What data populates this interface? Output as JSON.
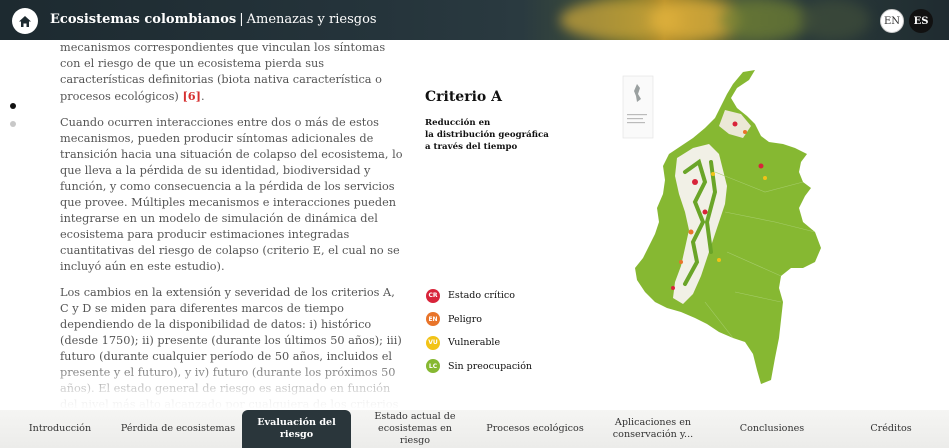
{
  "header": {
    "title_bold": "Ecosistemas colombianos",
    "separator": "|",
    "title_rest": "Amenazas y riesgos",
    "lang_en": "EN",
    "lang_es": "ES"
  },
  "body": {
    "p1_text": "mecanismos correspondientes que vinculan los síntomas con el riesgo de que un ecosistema pierda sus características definitorias (biota nativa característica o procesos ecológicos)",
    "p1_ref": "[6]",
    "p1_end": ".",
    "p2": "Cuando ocurren interacciones entre dos o más de estos mecanismos, pueden producir síntomas adicionales de transición hacia una situación de colapso del ecosistema, lo que lleva a la pérdida de su identidad, biodiversidad y función, y como consecuencia a la pérdida de los servicios que provee. Múltiples mecanismos e interacciones pueden integrarse en un modelo de simulación de dinámica del ecosistema para producir estimaciones integradas cuantitativas del riesgo de colapso (criterio E, el cual no se incluyó aún en este estudio).",
    "p3": "Los cambios en la extensión y severidad de los criterios A, C y D se miden para diferentes marcos de tiempo dependiendo de la disponibilidad de datos: i) histórico (desde 1750); ii) presente (durante los últimos 50 años); iii) futuro (durante cualquier período de 50 años, incluidos el presente y el futuro), y iv) futuro (durante los próximos 50 años). El estado general de riesgo es asignado en función del nivel más alto alcanzado por cualquiera de los criterios de evaluación, ya que el riesgo global se considera que está determinado por el factor más limitante."
  },
  "criterion": {
    "title": "Criterio A",
    "subtitle_1": "Reducción en",
    "subtitle_2": "la distribución geográfica",
    "subtitle_3": "a través del tiempo"
  },
  "legend": [
    {
      "code": "CR",
      "label": "Estado crítico",
      "color": "#d8243a"
    },
    {
      "code": "EN",
      "label": "Peligro",
      "color": "#e8742a"
    },
    {
      "code": "VU",
      "label": "Vulnerable",
      "color": "#f2c316"
    },
    {
      "code": "LC",
      "label": "Sin preocupación",
      "color": "#86b832"
    }
  ],
  "nav": [
    {
      "label": "Introducción",
      "active": false
    },
    {
      "label": "Pérdida de ecosistemas",
      "active": false
    },
    {
      "label": "Evaluación del riesgo",
      "active": true
    },
    {
      "label": "Estado actual de ecosistemas en riesgo",
      "active": false
    },
    {
      "label": "Procesos ecológicos",
      "active": false
    },
    {
      "label": "Aplicaciones en conservación y...",
      "active": false
    },
    {
      "label": "Conclusiones",
      "active": false
    },
    {
      "label": "Créditos",
      "active": false
    }
  ],
  "icons": {
    "home": "home-icon"
  },
  "colors": {
    "header_bg": "#1d2a30",
    "active_tab": "#2a363b",
    "ref": "#d63030",
    "map_green": "#86b832"
  }
}
